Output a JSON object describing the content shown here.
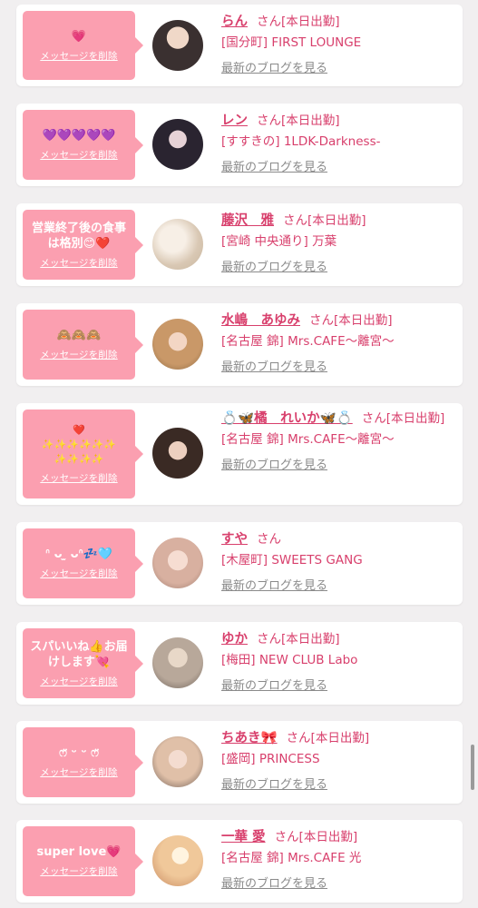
{
  "delete_label": "メッセージを削除",
  "blog_label": "最新のブログを見る",
  "colors": {
    "accent": "#d83f6c",
    "bubble": "#fb9fb0",
    "link_gray": "#8a8a8a"
  },
  "items": [
    {
      "message": "💗",
      "name": "らん",
      "suffix": "さん[本日出勤]",
      "shop": "[国分町] FIRST LOUNGE"
    },
    {
      "message": "💜💜💜💜💜",
      "name": "レン",
      "suffix": "さん[本日出勤]",
      "shop": "[すすきの] 1LDK-Darkness-"
    },
    {
      "message": "営業終了後の食事は格別😊❤️",
      "name": "藤沢　雅",
      "suffix": "さん[本日出勤]",
      "shop": "[宮崎 中央通り] 万葉"
    },
    {
      "message": "🙈🙈🙈",
      "name": "水嶋　あゆみ",
      "suffix": "さん[本日出勤]",
      "shop": "[名古屋 錦] Mrs.CAFE〜離宮〜"
    },
    {
      "message": "❤️\n✨✨✨✨✨✨\n✨✨✨✨",
      "name": "💍🦋橘　れいか🦋💍",
      "suffix": "さん[本日出勤]",
      "shop": "[名古屋 錦] Mrs.CAFE〜離宮〜"
    },
    {
      "message": "ᐢ ᴗ ̫ ᴗᐢ💤🩵",
      "name": "すや",
      "suffix": "さん",
      "shop": "[木屋町] SWEETS GANG"
    },
    {
      "message": "スパいいね👍お届けします💘",
      "name": "ゆか",
      "suffix": "さん[本日出勤]",
      "shop": "[梅田] NEW CLUB Labo"
    },
    {
      "message": "ෆ̈ ᵕ ᵕ ෆ̈",
      "name": "ちあき🎀",
      "suffix": "さん[本日出勤]",
      "shop": "[盛岡] PRINCESS"
    },
    {
      "message": "super love💗",
      "name": "一華 愛",
      "suffix": "さん[本日出勤]",
      "shop": "[名古屋 錦] Mrs.CAFE 光"
    }
  ]
}
